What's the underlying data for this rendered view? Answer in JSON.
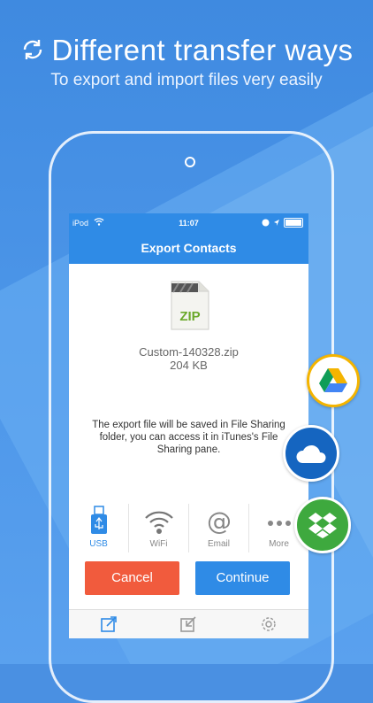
{
  "headline": "Different transfer ways",
  "subheadline": "To export and import files very easily",
  "statusbar": {
    "carrier": "iPod",
    "time": "11:07"
  },
  "navbar": {
    "title": "Export Contacts"
  },
  "file": {
    "icon_label": "ZIP",
    "name": "Custom-140328.zip",
    "size": "204 KB"
  },
  "message": "The export file will be saved in File Sharing folder, you can access it in iTunes's File Sharing pane.",
  "methods": [
    {
      "label": "USB",
      "icon": "usb-icon",
      "active": true
    },
    {
      "label": "WiFi",
      "icon": "wifi-icon",
      "active": false
    },
    {
      "label": "Email",
      "icon": "at-sign-icon",
      "active": false
    },
    {
      "label": "More",
      "icon": "more-dots-icon",
      "active": false
    }
  ],
  "buttons": {
    "cancel": "Cancel",
    "continue": "Continue"
  },
  "tabs": [
    "export-icon",
    "import-icon",
    "settings-icon"
  ],
  "cloud_services": [
    "google-drive-icon",
    "onedrive-icon",
    "dropbox-icon"
  ],
  "colors": {
    "accent": "#2f8be6",
    "cancel": "#f15b3d",
    "background": "#4a90e2"
  }
}
